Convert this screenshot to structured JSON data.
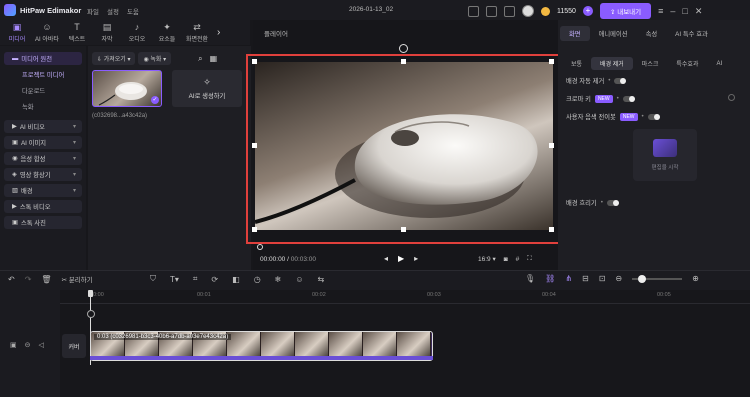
{
  "app": {
    "name": "HitPaw Edimakor",
    "doc_title": "2026-01-13_02",
    "credits": "11550",
    "export_label": "내보내기"
  },
  "menus": [
    "파일",
    "설정",
    "도움"
  ],
  "tool_tabs": [
    {
      "label": "미디어",
      "glyph": "▣",
      "icon": "media-icon"
    },
    {
      "label": "AI 아바타",
      "glyph": "☺",
      "icon": "ai-avatar-icon"
    },
    {
      "label": "텍스트",
      "glyph": "T",
      "icon": "text-icon"
    },
    {
      "label": "자막",
      "glyph": "▤",
      "icon": "subtitle-icon"
    },
    {
      "label": "오디오",
      "glyph": "♪",
      "icon": "audio-icon"
    },
    {
      "label": "요소들",
      "glyph": "✦",
      "icon": "elements-icon"
    },
    {
      "label": "화면전환",
      "glyph": "⇄",
      "icon": "transition-icon"
    }
  ],
  "left_nav": {
    "media_section": "미디어 원천",
    "project_media": "프로젝트 미디어",
    "download": "다운로드",
    "record": "녹화",
    "items": [
      "AI 비디오",
      "AI 이미지",
      "음성 합성",
      "영상 향상기",
      "배경",
      "스톡 비디오",
      "스톡 사진"
    ]
  },
  "media": {
    "import_label": "가져오기",
    "record_label": "녹화",
    "thumb_name": "(c032698...a43c42a)",
    "ai_gen_label": "AI로 생성하기"
  },
  "player": {
    "label": "플레이어",
    "time_current": "00:00:00",
    "time_total": "00:03:00",
    "aspect": "16:9"
  },
  "right_panel": {
    "tabs": [
      "화면",
      "애니메이션",
      "속성",
      "AI 특수 효과"
    ],
    "subtabs": [
      "보통",
      "배경 제거",
      "마스크",
      "특수효과",
      "AI"
    ],
    "bg_remove_auto": "배경 자동 제거",
    "chroma_key": "크로마 키",
    "new_badge": "NEW",
    "human_remove": "사용자 음색 전이봇",
    "bg_blur": "배경 흐리기",
    "cr_label": "편집을 시작"
  },
  "timeline_toolbar": {
    "split_label": "분리하기"
  },
  "timeline": {
    "ticks": [
      "00:00",
      "00:01",
      "00:02",
      "00:03",
      "00:04",
      "00:05"
    ],
    "cover_label": "커버",
    "clip_label": "0:03 (c0326981-b3c3-40b6-a7db-a03e7e43c42a)"
  }
}
